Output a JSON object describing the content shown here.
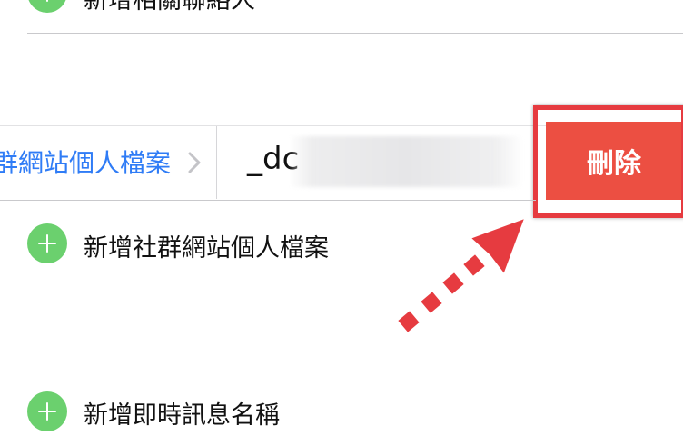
{
  "rows": {
    "top_add_label": "新增相關聯絡人",
    "add_social_label": "新增社群網站個人檔案",
    "add_im_label": "新增即時訊息名稱"
  },
  "social_field": {
    "type_label": "群網站個人檔案",
    "value_visible": "_dc"
  },
  "delete_button": {
    "label": "刪除"
  },
  "colors": {
    "delete_red": "#ec4f42",
    "link_blue": "#2f7cf6",
    "add_green": "#6bd06e",
    "annotation_red": "#e63b40"
  },
  "icons": {
    "add": "plus-circle-icon",
    "chevron": "chevron-right-icon",
    "arrow": "dotted-arrow-annotation"
  }
}
